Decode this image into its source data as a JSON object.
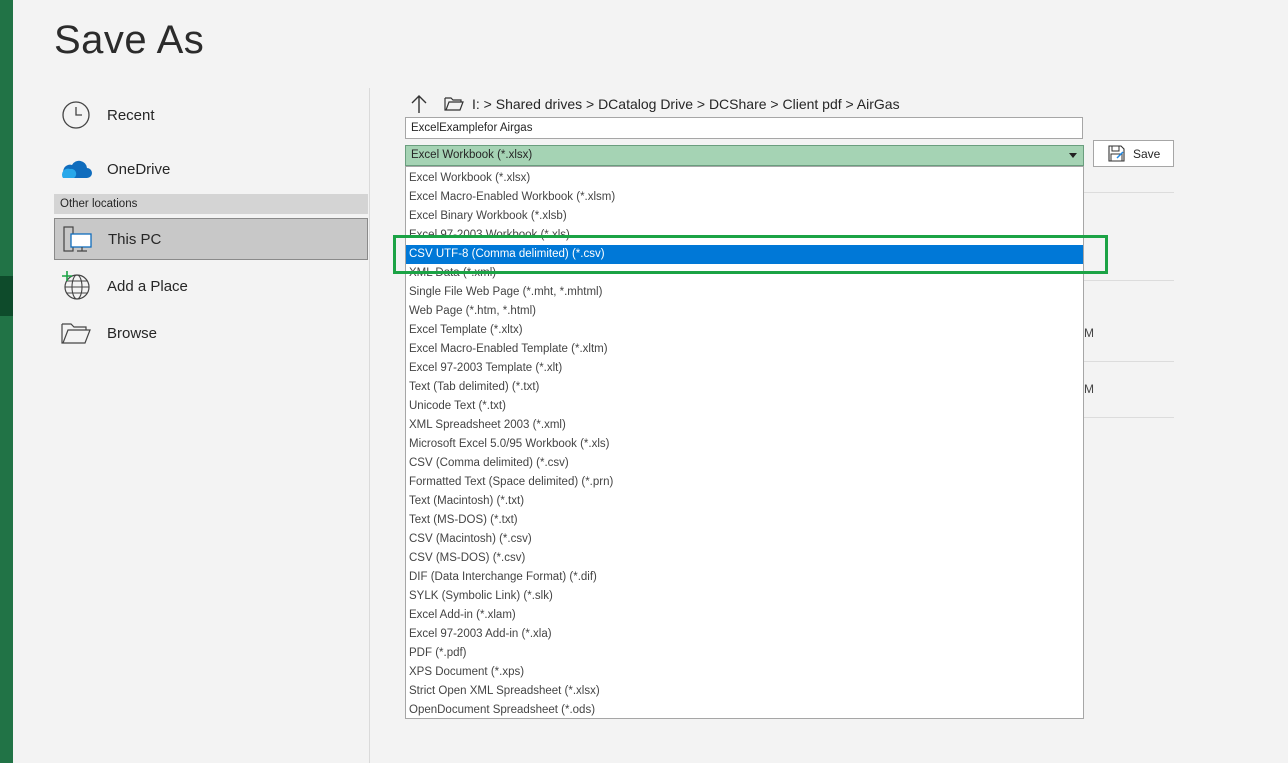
{
  "page": {
    "title": "Save As"
  },
  "nav": {
    "recent": "Recent",
    "onedrive": "OneDrive",
    "other_locations": "Other locations",
    "this_pc": "This PC",
    "add_place": "Add a Place",
    "browse": "Browse"
  },
  "breadcrumb": {
    "path": "I: > Shared drives > DCatalog Drive > DCShare > Client pdf > AirGas"
  },
  "filename": {
    "value": "ExcelExamplefor Airgas"
  },
  "filetype": {
    "selected": "Excel Workbook (*.xlsx)"
  },
  "save_button": {
    "label": "Save"
  },
  "background": {
    "frag1": "M",
    "frag2": "M"
  },
  "dropdown": {
    "items": [
      "Excel Workbook (*.xlsx)",
      "Excel Macro-Enabled Workbook (*.xlsm)",
      "Excel Binary Workbook (*.xlsb)",
      "Excel 97-2003 Workbook (*.xls)",
      "CSV UTF-8 (Comma delimited) (*.csv)",
      "XML Data (*.xml)",
      "Single File Web Page (*.mht, *.mhtml)",
      "Web Page (*.htm, *.html)",
      "Excel Template (*.xltx)",
      "Excel Macro-Enabled Template (*.xltm)",
      "Excel 97-2003 Template (*.xlt)",
      "Text (Tab delimited) (*.txt)",
      "Unicode Text (*.txt)",
      "XML Spreadsheet 2003 (*.xml)",
      "Microsoft Excel 5.0/95 Workbook (*.xls)",
      "CSV (Comma delimited) (*.csv)",
      "Formatted Text (Space delimited) (*.prn)",
      "Text (Macintosh) (*.txt)",
      "Text (MS-DOS) (*.txt)",
      "CSV (Macintosh) (*.csv)",
      "CSV (MS-DOS) (*.csv)",
      "DIF (Data Interchange Format) (*.dif)",
      "SYLK (Symbolic Link) (*.slk)",
      "Excel Add-in (*.xlam)",
      "Excel 97-2003 Add-in (*.xla)",
      "PDF (*.pdf)",
      "XPS Document (*.xps)",
      "Strict Open XML Spreadsheet (*.xlsx)",
      "OpenDocument Spreadsheet (*.ods)"
    ],
    "selected_index": 4
  },
  "colors": {
    "accent_green": "#217346",
    "selection_blue": "#0078d7",
    "highlight_box": "#1ba345"
  }
}
